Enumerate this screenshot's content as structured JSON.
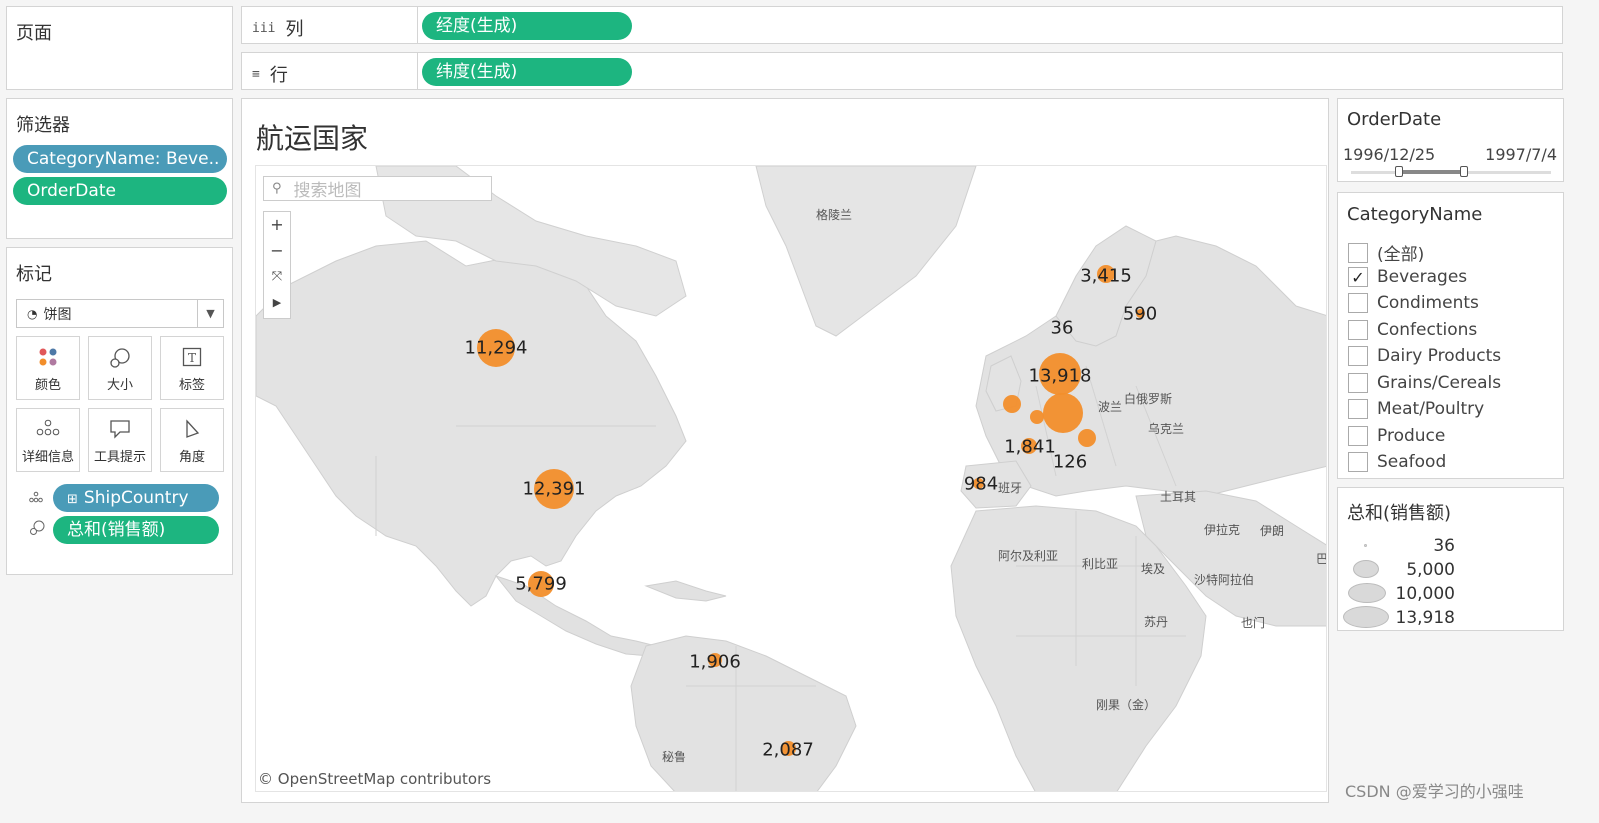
{
  "pages_panel": {
    "title": "页面"
  },
  "columns_shelf": {
    "icon": "iii",
    "label": "列",
    "pill": "经度(生成)"
  },
  "rows_shelf": {
    "icon": "≡",
    "label": "行",
    "pill": "纬度(生成)"
  },
  "filters_panel": {
    "title": "筛选器",
    "filters": [
      "CategoryName: Beve..",
      "OrderDate"
    ]
  },
  "marks_panel": {
    "title": "标记",
    "mark_type": "饼图",
    "buttons": [
      {
        "label": "颜色",
        "icon": "color-icon"
      },
      {
        "label": "大小",
        "icon": "size-icon"
      },
      {
        "label": "标签",
        "icon": "label-icon"
      },
      {
        "label": "详细信息",
        "icon": "detail-icon"
      },
      {
        "label": "工具提示",
        "icon": "tooltip-icon"
      },
      {
        "label": "角度",
        "icon": "angle-icon"
      }
    ],
    "fields": [
      {
        "icon": "detail-icon",
        "prefix": "⊞",
        "label": "ShipCountry",
        "color": "#4a9bb8"
      },
      {
        "icon": "size-icon",
        "prefix": "",
        "label": "总和(销售额)",
        "color": "#1db580"
      }
    ]
  },
  "view": {
    "title": "航运国家",
    "search_placeholder": "搜索地图",
    "attribution": "© OpenStreetMap contributors",
    "map_labels": [
      "格陵兰",
      "波兰",
      "白俄罗斯",
      "乌克兰",
      "班牙",
      "土耳其",
      "伊拉克",
      "伊朗",
      "阿尔及利亚",
      "利比亚",
      "埃及",
      "沙特阿拉伯",
      "苏丹",
      "也门",
      "刚果（金）",
      "秘鲁",
      "巴"
    ],
    "bubbles": [
      {
        "label": "11,294",
        "value": 11294
      },
      {
        "label": "12,391",
        "value": 12391
      },
      {
        "label": "5,799",
        "value": 5799
      },
      {
        "label": "1,906",
        "value": 1906
      },
      {
        "label": "2,087",
        "value": 2087
      },
      {
        "label": "3,415",
        "value": 3415
      },
      {
        "label": "590",
        "value": 590
      },
      {
        "label": "36",
        "value": 36
      },
      {
        "label": "13,918",
        "value": 13918
      },
      {
        "label": "1,841",
        "value": 1841
      },
      {
        "label": "126",
        "value": 126
      },
      {
        "label": "984",
        "value": 984
      }
    ]
  },
  "order_date": {
    "title": "OrderDate",
    "start": "1996/12/25",
    "end": "1997/7/4"
  },
  "category": {
    "title": "CategoryName",
    "items": [
      {
        "label": "(全部)",
        "checked": false
      },
      {
        "label": "Beverages",
        "checked": true
      },
      {
        "label": "Condiments",
        "checked": false
      },
      {
        "label": "Confections",
        "checked": false
      },
      {
        "label": "Dairy Products",
        "checked": false
      },
      {
        "label": "Grains/Cereals",
        "checked": false
      },
      {
        "label": "Meat/Poultry",
        "checked": false
      },
      {
        "label": "Produce",
        "checked": false
      },
      {
        "label": "Seafood",
        "checked": false
      }
    ]
  },
  "size_legend": {
    "title": "总和(销售额)",
    "values": [
      "36",
      "5,000",
      "10,000",
      "13,918"
    ]
  },
  "watermark": "CSDN @爱学习的小强哇",
  "colors": {
    "accent_green": "#1db580",
    "accent_blue": "#4a9bb8",
    "bubble": "#f28e2b"
  }
}
